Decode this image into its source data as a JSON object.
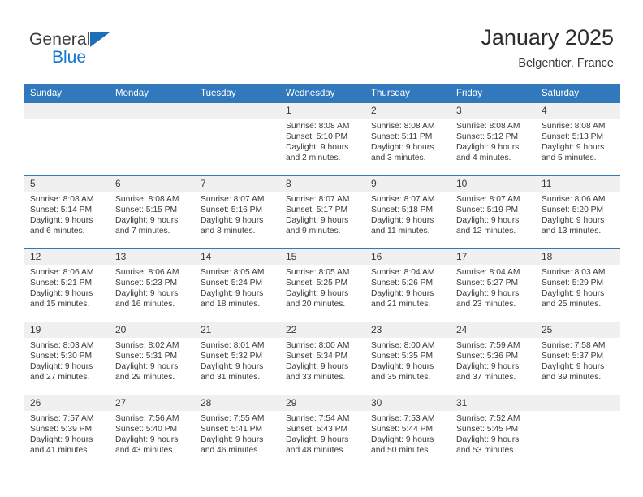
{
  "brand": {
    "name_part1": "General",
    "name_part2": "Blue",
    "triangle_icon": "triangle-icon",
    "colors": {
      "dark": "#3c3c3c",
      "blue": "#1176d1",
      "triangle": "#1c6fb8"
    }
  },
  "header": {
    "title": "January 2025",
    "subtitle": "Belgentier, France"
  },
  "theme": {
    "header_bg": "#3179bc",
    "header_text": "#ffffff",
    "daynum_bg": "#f0f0f0",
    "row_divider": "#3179bc",
    "body_text": "#3a3a3a"
  },
  "calendar": {
    "weekday_headers": [
      "Sunday",
      "Monday",
      "Tuesday",
      "Wednesday",
      "Thursday",
      "Friday",
      "Saturday"
    ],
    "labels": {
      "sunrise": "Sunrise:",
      "sunset": "Sunset:",
      "daylight": "Daylight:"
    },
    "weeks": [
      [
        {
          "day": "",
          "sunrise": "",
          "sunset": "",
          "daylight": ""
        },
        {
          "day": "",
          "sunrise": "",
          "sunset": "",
          "daylight": ""
        },
        {
          "day": "",
          "sunrise": "",
          "sunset": "",
          "daylight": ""
        },
        {
          "day": "1",
          "sunrise": "Sunrise: 8:08 AM",
          "sunset": "Sunset: 5:10 PM",
          "daylight": "Daylight: 9 hours and 2 minutes."
        },
        {
          "day": "2",
          "sunrise": "Sunrise: 8:08 AM",
          "sunset": "Sunset: 5:11 PM",
          "daylight": "Daylight: 9 hours and 3 minutes."
        },
        {
          "day": "3",
          "sunrise": "Sunrise: 8:08 AM",
          "sunset": "Sunset: 5:12 PM",
          "daylight": "Daylight: 9 hours and 4 minutes."
        },
        {
          "day": "4",
          "sunrise": "Sunrise: 8:08 AM",
          "sunset": "Sunset: 5:13 PM",
          "daylight": "Daylight: 9 hours and 5 minutes."
        }
      ],
      [
        {
          "day": "5",
          "sunrise": "Sunrise: 8:08 AM",
          "sunset": "Sunset: 5:14 PM",
          "daylight": "Daylight: 9 hours and 6 minutes."
        },
        {
          "day": "6",
          "sunrise": "Sunrise: 8:08 AM",
          "sunset": "Sunset: 5:15 PM",
          "daylight": "Daylight: 9 hours and 7 minutes."
        },
        {
          "day": "7",
          "sunrise": "Sunrise: 8:07 AM",
          "sunset": "Sunset: 5:16 PM",
          "daylight": "Daylight: 9 hours and 8 minutes."
        },
        {
          "day": "8",
          "sunrise": "Sunrise: 8:07 AM",
          "sunset": "Sunset: 5:17 PM",
          "daylight": "Daylight: 9 hours and 9 minutes."
        },
        {
          "day": "9",
          "sunrise": "Sunrise: 8:07 AM",
          "sunset": "Sunset: 5:18 PM",
          "daylight": "Daylight: 9 hours and 11 minutes."
        },
        {
          "day": "10",
          "sunrise": "Sunrise: 8:07 AM",
          "sunset": "Sunset: 5:19 PM",
          "daylight": "Daylight: 9 hours and 12 minutes."
        },
        {
          "day": "11",
          "sunrise": "Sunrise: 8:06 AM",
          "sunset": "Sunset: 5:20 PM",
          "daylight": "Daylight: 9 hours and 13 minutes."
        }
      ],
      [
        {
          "day": "12",
          "sunrise": "Sunrise: 8:06 AM",
          "sunset": "Sunset: 5:21 PM",
          "daylight": "Daylight: 9 hours and 15 minutes."
        },
        {
          "day": "13",
          "sunrise": "Sunrise: 8:06 AM",
          "sunset": "Sunset: 5:23 PM",
          "daylight": "Daylight: 9 hours and 16 minutes."
        },
        {
          "day": "14",
          "sunrise": "Sunrise: 8:05 AM",
          "sunset": "Sunset: 5:24 PM",
          "daylight": "Daylight: 9 hours and 18 minutes."
        },
        {
          "day": "15",
          "sunrise": "Sunrise: 8:05 AM",
          "sunset": "Sunset: 5:25 PM",
          "daylight": "Daylight: 9 hours and 20 minutes."
        },
        {
          "day": "16",
          "sunrise": "Sunrise: 8:04 AM",
          "sunset": "Sunset: 5:26 PM",
          "daylight": "Daylight: 9 hours and 21 minutes."
        },
        {
          "day": "17",
          "sunrise": "Sunrise: 8:04 AM",
          "sunset": "Sunset: 5:27 PM",
          "daylight": "Daylight: 9 hours and 23 minutes."
        },
        {
          "day": "18",
          "sunrise": "Sunrise: 8:03 AM",
          "sunset": "Sunset: 5:29 PM",
          "daylight": "Daylight: 9 hours and 25 minutes."
        }
      ],
      [
        {
          "day": "19",
          "sunrise": "Sunrise: 8:03 AM",
          "sunset": "Sunset: 5:30 PM",
          "daylight": "Daylight: 9 hours and 27 minutes."
        },
        {
          "day": "20",
          "sunrise": "Sunrise: 8:02 AM",
          "sunset": "Sunset: 5:31 PM",
          "daylight": "Daylight: 9 hours and 29 minutes."
        },
        {
          "day": "21",
          "sunrise": "Sunrise: 8:01 AM",
          "sunset": "Sunset: 5:32 PM",
          "daylight": "Daylight: 9 hours and 31 minutes."
        },
        {
          "day": "22",
          "sunrise": "Sunrise: 8:00 AM",
          "sunset": "Sunset: 5:34 PM",
          "daylight": "Daylight: 9 hours and 33 minutes."
        },
        {
          "day": "23",
          "sunrise": "Sunrise: 8:00 AM",
          "sunset": "Sunset: 5:35 PM",
          "daylight": "Daylight: 9 hours and 35 minutes."
        },
        {
          "day": "24",
          "sunrise": "Sunrise: 7:59 AM",
          "sunset": "Sunset: 5:36 PM",
          "daylight": "Daylight: 9 hours and 37 minutes."
        },
        {
          "day": "25",
          "sunrise": "Sunrise: 7:58 AM",
          "sunset": "Sunset: 5:37 PM",
          "daylight": "Daylight: 9 hours and 39 minutes."
        }
      ],
      [
        {
          "day": "26",
          "sunrise": "Sunrise: 7:57 AM",
          "sunset": "Sunset: 5:39 PM",
          "daylight": "Daylight: 9 hours and 41 minutes."
        },
        {
          "day": "27",
          "sunrise": "Sunrise: 7:56 AM",
          "sunset": "Sunset: 5:40 PM",
          "daylight": "Daylight: 9 hours and 43 minutes."
        },
        {
          "day": "28",
          "sunrise": "Sunrise: 7:55 AM",
          "sunset": "Sunset: 5:41 PM",
          "daylight": "Daylight: 9 hours and 46 minutes."
        },
        {
          "day": "29",
          "sunrise": "Sunrise: 7:54 AM",
          "sunset": "Sunset: 5:43 PM",
          "daylight": "Daylight: 9 hours and 48 minutes."
        },
        {
          "day": "30",
          "sunrise": "Sunrise: 7:53 AM",
          "sunset": "Sunset: 5:44 PM",
          "daylight": "Daylight: 9 hours and 50 minutes."
        },
        {
          "day": "31",
          "sunrise": "Sunrise: 7:52 AM",
          "sunset": "Sunset: 5:45 PM",
          "daylight": "Daylight: 9 hours and 53 minutes."
        },
        {
          "day": "",
          "sunrise": "",
          "sunset": "",
          "daylight": ""
        }
      ]
    ]
  }
}
